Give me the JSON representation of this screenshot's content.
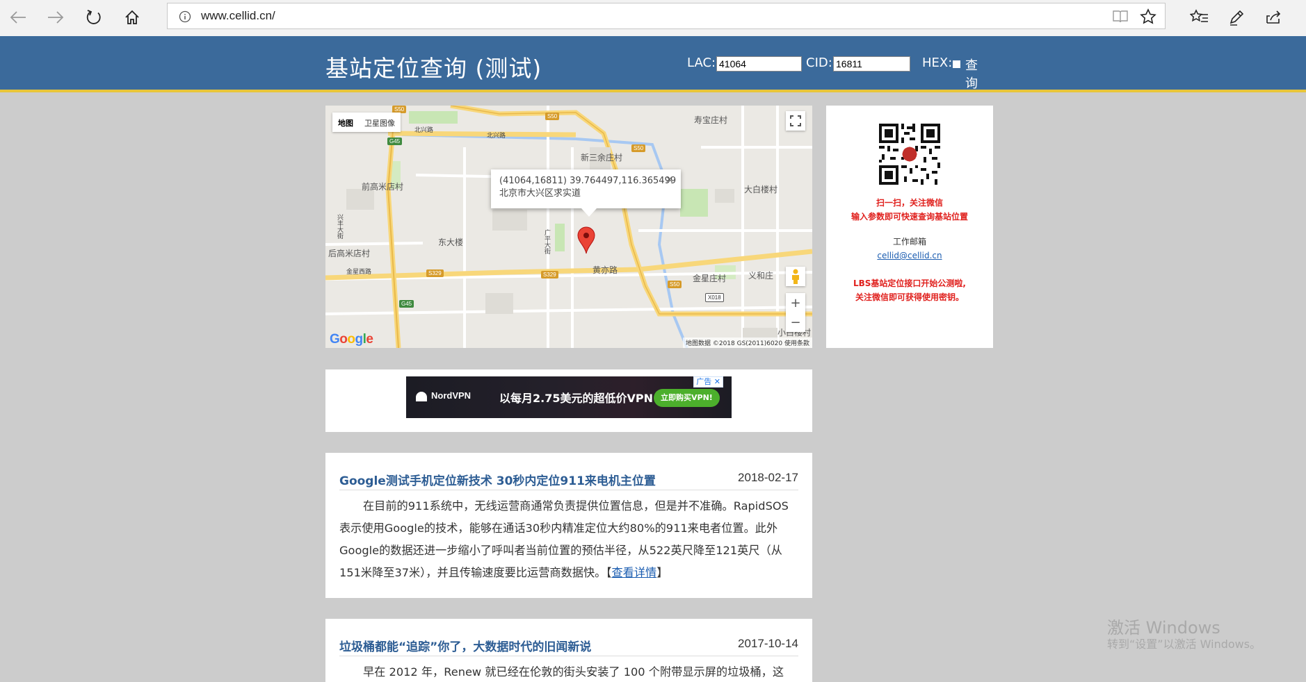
{
  "browser": {
    "url": "www.cellid.cn/"
  },
  "header": {
    "title": "基站定位查询 (测试)",
    "lac_label": "LAC:",
    "lac_value": "41064",
    "cid_label": "CID:",
    "cid_value": "16811",
    "hex_label": "HEX:",
    "query_label": "查 询"
  },
  "map": {
    "type_map": "地图",
    "type_satellite": "卫星图像",
    "info_line1": "(41064,16811) 39.764497,116.365499",
    "info_line2": "北京市大兴区求实道",
    "close": "×",
    "zoom_in": "+",
    "zoom_out": "−",
    "google": "Google",
    "attribution": "地图数据 ©2018 GS(2011)6020    使用条款",
    "places": {
      "shoubao": "寿宝庄村",
      "xinsanyu": "新三余庄村",
      "qiangaomi": "前高米店村",
      "dabailou": "大白楼村",
      "dongdalou": "东大楼",
      "hougaomi": "后高米店村",
      "jinxing": "金星庄村",
      "yihe": "义和庄",
      "xiaobai": "小白楼村",
      "huangchi": "黄亦路",
      "beixing": "北兴路",
      "beixing2": "北兴路",
      "jinxingxi": "金星西路",
      "xingfeng": "兴丰大街",
      "guangping": "广平大街"
    },
    "shields": {
      "s50a": "S50",
      "s50b": "S50",
      "s50c": "S50",
      "s50d": "S50",
      "g45a": "G45",
      "g45b": "G45",
      "s329a": "S329",
      "s329b": "S329",
      "x018": "X018"
    }
  },
  "sidebar": {
    "line1": "扫一扫，关注微信",
    "line2": "输入参数即可快速查询基站位置",
    "email_label": "工作邮箱",
    "email": "cellid@cellid.cn",
    "promo1": "LBS基站定位接口开始公测啦,",
    "promo2": "关注微信即可获得使用密钥。"
  },
  "ad": {
    "brand": "NordVPN",
    "text": "以每月2.75美元的超低价VPN",
    "cta": "立即购买VPN!",
    "tag": "广告 ✕"
  },
  "articles": [
    {
      "title": "Google测试手机定位新技术 30秒内定位911来电机主位置",
      "date": "2018-02-17",
      "body": "在目前的911系统中，无线运营商通常负责提供位置信息，但是并不准确。RapidSOS表示使用Google的技术，能够在通话30秒内精准定位大约80%的911来电者位置。此外Google的数据还进一步缩小了呼叫者当前位置的预估半径，从522英尺降至121英尺（从151米降至37米），并且传输速度要比运营商数据快。",
      "link_open": "【",
      "link": "查看详情",
      "link_close": "】"
    },
    {
      "title": "垃圾桶都能“追踪”你了，大数据时代的旧闻新说",
      "date": "2017-10-14",
      "body": "早在 2012 年，Renew 就已经在伦敦的街头安装了 100 个附带显示屏的垃圾桶，这"
    }
  ],
  "watermark": {
    "line1": "激活 Windows",
    "line2": "转到“设置”以激活 Windows。"
  }
}
